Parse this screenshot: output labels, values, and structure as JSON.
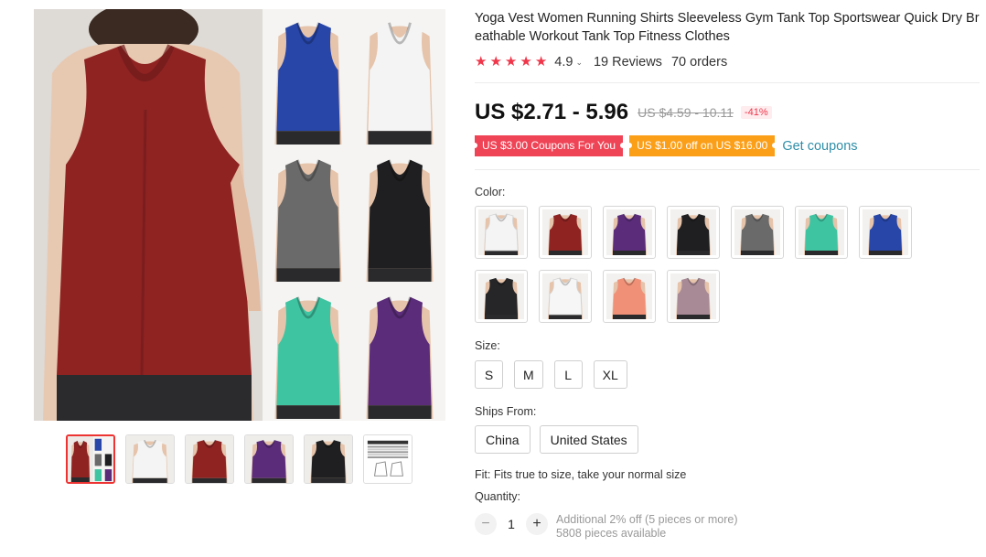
{
  "product": {
    "title": "Yoga Vest Women Running Shirts Sleeveless Gym Tank Top Sportswear Quick Dry Breathable Workout Tank Top Fitness Clothes",
    "rating": "4.9",
    "reviews": "19 Reviews",
    "orders": "70 orders",
    "price": "US $2.71 - 5.96",
    "old_price": "US $4.59 - 10.11",
    "discount": "-41%"
  },
  "coupons": {
    "coupon1": "US $3.00 Coupons For You",
    "coupon2": "US $1.00 off on US $16.00",
    "get_coupons": "Get coupons"
  },
  "color": {
    "label": "Color:",
    "options": [
      {
        "name": "white",
        "color": "#f4f4f4"
      },
      {
        "name": "wine red",
        "color": "#8e2322"
      },
      {
        "name": "purple",
        "color": "#5b2c7a"
      },
      {
        "name": "black",
        "color": "#1f1f21"
      },
      {
        "name": "gray",
        "color": "#6a6a6a"
      },
      {
        "name": "mint green",
        "color": "#3fc4a2"
      },
      {
        "name": "royal blue",
        "color": "#2746a8"
      },
      {
        "name": "black back",
        "color": "#262628"
      },
      {
        "name": "white back",
        "color": "#f6f6f6"
      },
      {
        "name": "coral",
        "color": "#f09077"
      },
      {
        "name": "mauve",
        "color": "#a88a96"
      }
    ]
  },
  "size": {
    "label": "Size:",
    "options": [
      "S",
      "M",
      "L",
      "XL"
    ]
  },
  "ships_from": {
    "label": "Ships From:",
    "options": [
      "China",
      "United States"
    ]
  },
  "fit_text": "Fit: Fits true to size, take your normal size",
  "quantity": {
    "label": "Quantity:",
    "value": "1",
    "minus": "−",
    "plus": "+",
    "note": "Additional 2% off (5 pieces or more)",
    "available": "5808 pieces available"
  },
  "icons": {
    "star": "★",
    "chevron": "⌄"
  },
  "gallery": {
    "thumb_colors": [
      "#8e2322",
      "#f4f4f4",
      "#8e2322",
      "#5b2c7a",
      "#1f1f21",
      "size-chart"
    ],
    "grid_colors": [
      "#2746a8",
      "#f4f4f4",
      "#6a6a6a",
      "#1f1f21",
      "#3fc4a2",
      "#5b2c7a"
    ],
    "main_color": "#8e2322"
  }
}
